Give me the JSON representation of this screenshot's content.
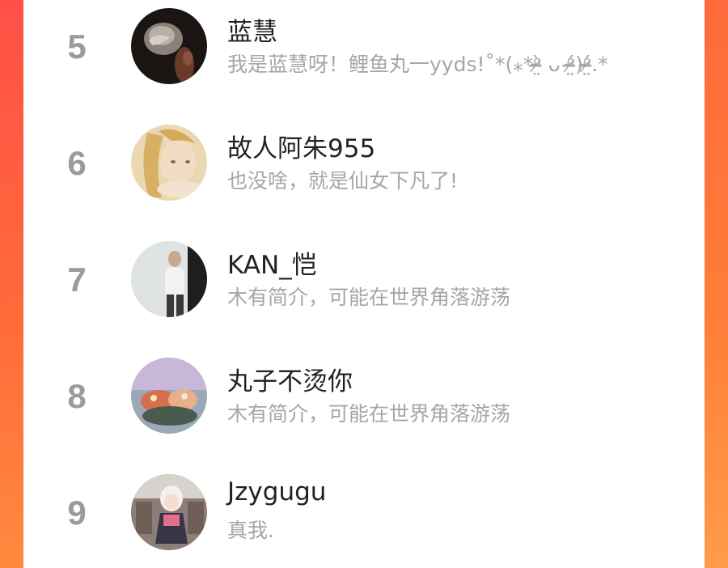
{
  "theme": {
    "frame_color": "#ff5a40",
    "panel_color": "#ffffff",
    "rank_color": "#9b9b9b",
    "name_color": "#222222",
    "bio_color": "#a6a6a6"
  },
  "list": {
    "items": [
      {
        "rank": "5",
        "name": "蓝慧",
        "bio": "我是蓝慧呀！鲤鱼丸一yyds!˚*(⁎*ᵒ̴̶̷̤̀ ᴗ ᵒ̴̶̷̤́)ᵒ̴̶̷̤́.*",
        "avatar": "portrait-dark-icon"
      },
      {
        "rank": "6",
        "name": "故人阿朱955",
        "bio": "也没啥，就是仙女下凡了!",
        "avatar": "portrait-girl-icon"
      },
      {
        "rank": "7",
        "name": "KAN_恺",
        "bio": "木有简介，可能在世界角落游荡",
        "avatar": "portrait-man-icon"
      },
      {
        "rank": "8",
        "name": "丸子不烫你",
        "bio": "木有简介，可能在世界角落游荡",
        "avatar": "portrait-food-icon"
      },
      {
        "rank": "9",
        "name": "Jzygugu",
        "bio": "真我.",
        "avatar": "portrait-anime-icon"
      }
    ]
  }
}
